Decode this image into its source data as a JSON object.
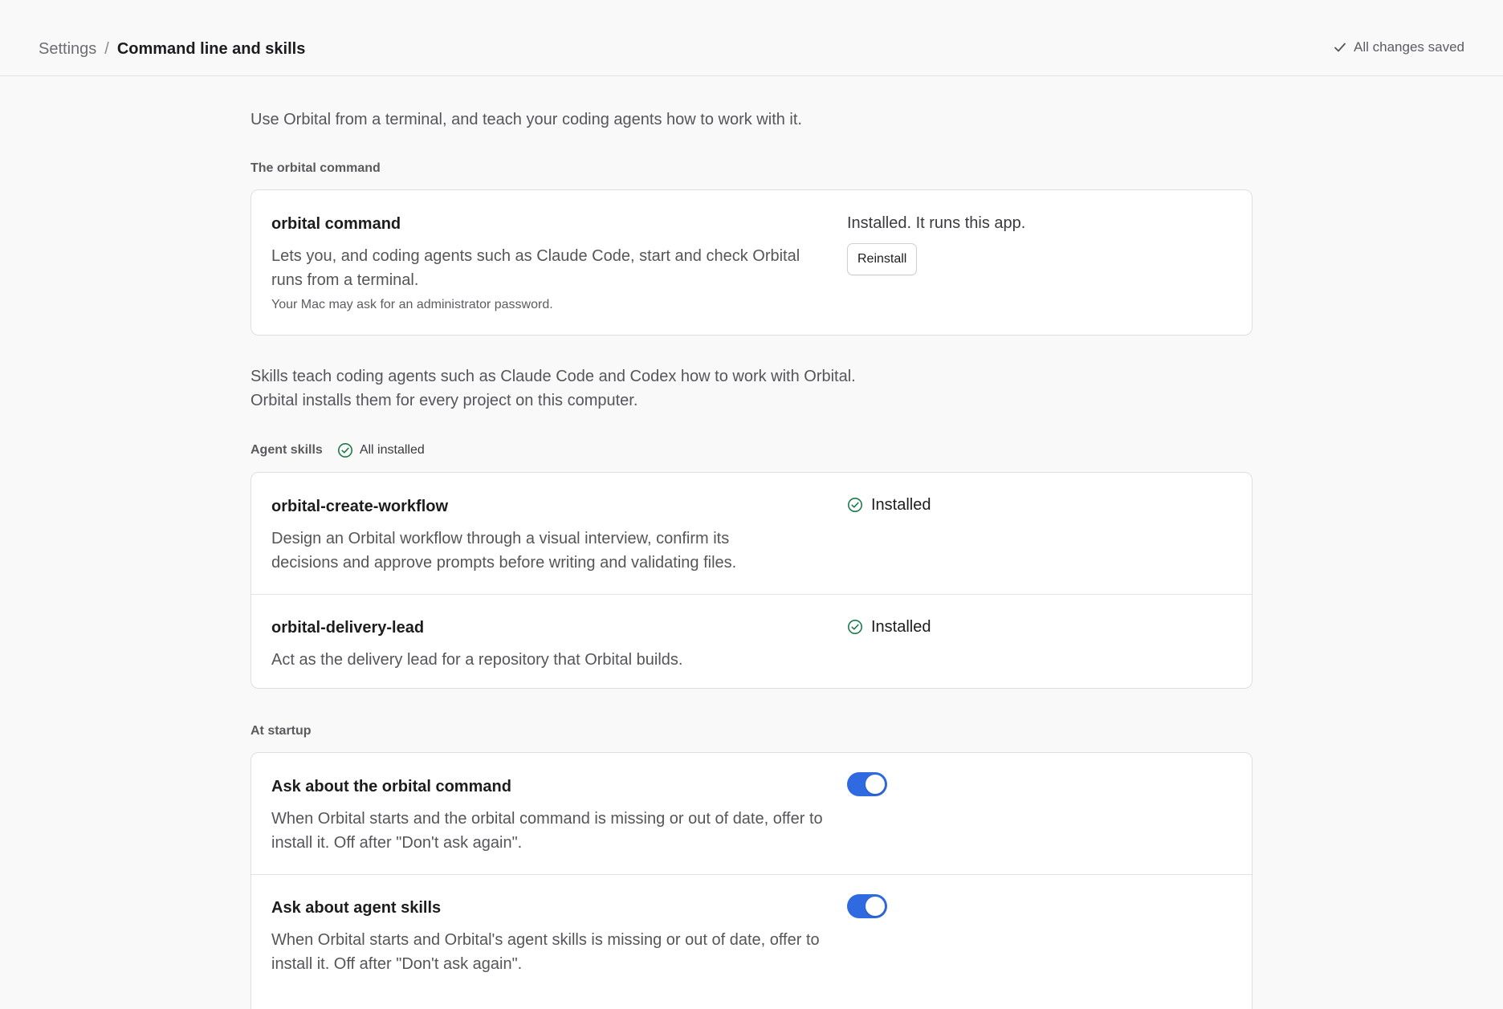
{
  "header": {
    "breadcrumb_root": "Settings",
    "breadcrumb_separator": "/",
    "breadcrumb_current": "Command line and skills",
    "save_status": "All changes saved"
  },
  "intro": "Use Orbital from a terminal, and teach your coding agents how to work with it.",
  "command_section": {
    "label": "The orbital command",
    "title": "orbital command",
    "description": "Lets you, and coding agents such as Claude Code, start and check Orbital runs from a terminal.",
    "note": "Your Mac may ask for an administrator password.",
    "status": "Installed. It runs this app.",
    "button_label": "Reinstall"
  },
  "skills_intro": {
    "line1": "Skills teach coding agents such as Claude Code and Codex how to work with Orbital.",
    "line2": "Orbital installs them for every project on this computer."
  },
  "skills_section": {
    "label": "Agent skills",
    "badge": "All installed",
    "items": [
      {
        "name": "orbital-create-workflow",
        "description": "Design an Orbital workflow through a visual interview, confirm its decisions and approve prompts before writing and validating files.",
        "status": "Installed"
      },
      {
        "name": "orbital-delivery-lead",
        "description": "Act as the delivery lead for a repository that Orbital builds.",
        "status": "Installed"
      }
    ]
  },
  "startup_section": {
    "label": "At startup",
    "items": [
      {
        "title": "Ask about the orbital command",
        "description": "When Orbital starts and the orbital command is missing or out of date, offer to install it. Off after \"Don't ask again\".",
        "enabled": true
      },
      {
        "title": "Ask about agent skills",
        "description": "When Orbital starts and Orbital's agent skills is missing or out of date, offer to install it. Off after \"Don't ask again\".",
        "enabled": true
      }
    ]
  },
  "colors": {
    "accent": "#2f6ae0",
    "success": "#1f7a4d",
    "background": "#f9f9fa",
    "card": "#ffffff"
  },
  "icons": {
    "save_status": "checkmark-icon",
    "installed": "check-circle-icon"
  }
}
